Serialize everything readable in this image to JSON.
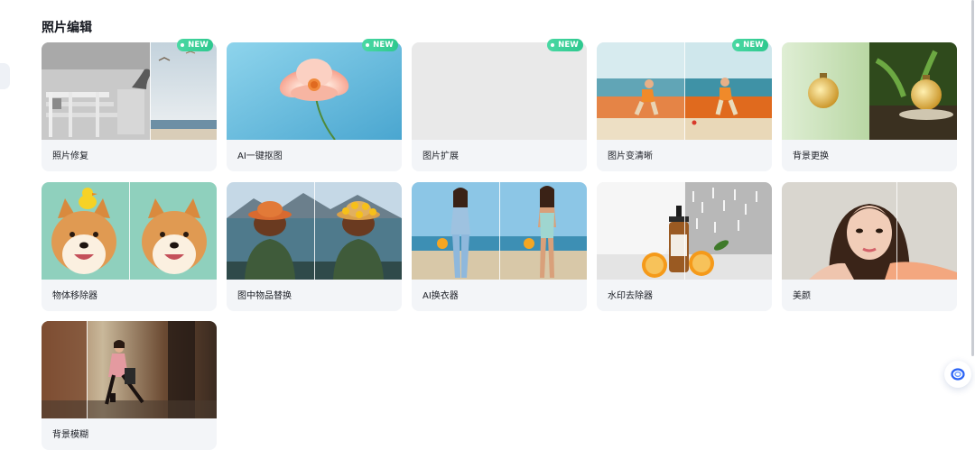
{
  "section": {
    "title": "照片编辑"
  },
  "badge_text": "NEW",
  "colors": {
    "badge": "#2dc88e",
    "card_bg": "#f3f5f8",
    "accent": "#2a63f5"
  },
  "tools": [
    {
      "label": "照片修复",
      "is_new": true,
      "thumb": "photo-repair"
    },
    {
      "label": "AI一键抠图",
      "is_new": true,
      "thumb": "cutout-flower"
    },
    {
      "label": "图片扩展",
      "is_new": true,
      "thumb": "blank"
    },
    {
      "label": "图片变清晰",
      "is_new": true,
      "thumb": "kids-beach"
    },
    {
      "label": "背景更换",
      "is_new": false,
      "thumb": "perfume"
    },
    {
      "label": "物体移除器",
      "is_new": false,
      "thumb": "shiba"
    },
    {
      "label": "图中物品替换",
      "is_new": false,
      "thumb": "hat-lake"
    },
    {
      "label": "AI换衣器",
      "is_new": false,
      "thumb": "beach-model"
    },
    {
      "label": "水印去除器",
      "is_new": false,
      "thumb": "serum-bottle"
    },
    {
      "label": "美颜",
      "is_new": false,
      "thumb": "portrait"
    },
    {
      "label": "背景模糊",
      "is_new": false,
      "thumb": "motion-blur"
    }
  ],
  "floating_button": {
    "icon": "assistant-ring-icon"
  }
}
